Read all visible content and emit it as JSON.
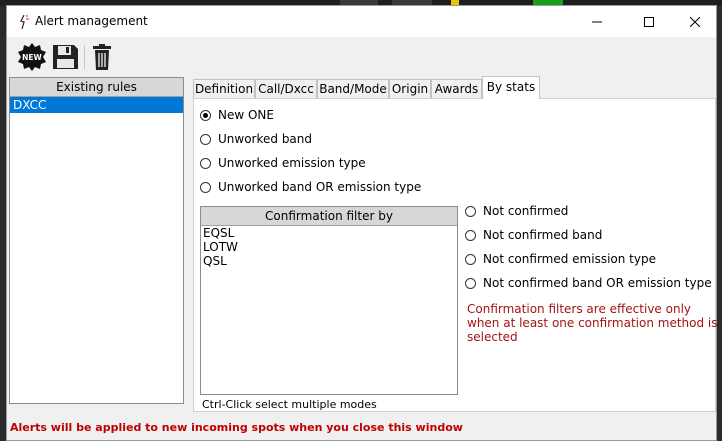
{
  "window": {
    "title": "Alert management"
  },
  "toolbar": {
    "new_badge": "NEW",
    "icons": [
      "new-icon",
      "save-icon",
      "trash-icon"
    ]
  },
  "rules": {
    "header": "Existing rules",
    "items": [
      "DXCC"
    ],
    "selected": "DXCC"
  },
  "tabs": [
    {
      "label": "Definition",
      "active": false
    },
    {
      "label": "Call/Dxcc",
      "active": false
    },
    {
      "label": "Band/Mode",
      "active": false
    },
    {
      "label": "Origin",
      "active": false
    },
    {
      "label": "Awards",
      "active": false
    },
    {
      "label": "By stats",
      "active": true
    }
  ],
  "by_stats": {
    "options": [
      {
        "label": "New ONE",
        "checked": true
      },
      {
        "label": "Unworked band",
        "checked": false
      },
      {
        "label": "Unworked emission type",
        "checked": false
      },
      {
        "label": "Unworked band OR emission type",
        "checked": false
      }
    ],
    "confirmation": {
      "header": "Confirmation filter by",
      "items": [
        "EQSL",
        "LOTW",
        "QSL"
      ],
      "hint": "Ctrl-Click select multiple modes"
    },
    "confirm_options": [
      {
        "label": "Not confirmed",
        "checked": false
      },
      {
        "label": "Not confirmed band",
        "checked": false
      },
      {
        "label": "Not confirmed emission type",
        "checked": false
      },
      {
        "label": "Not confirmed band OR emission type",
        "checked": false
      }
    ],
    "warning": "Confirmation filters are effective only when at least one confirmation method is selected"
  },
  "status": {
    "text": "Alerts will be applied to new incoming spots when you close this window"
  },
  "colors": {
    "selection": "#0078d7",
    "warning": "#a31515",
    "status": "#c00000"
  }
}
